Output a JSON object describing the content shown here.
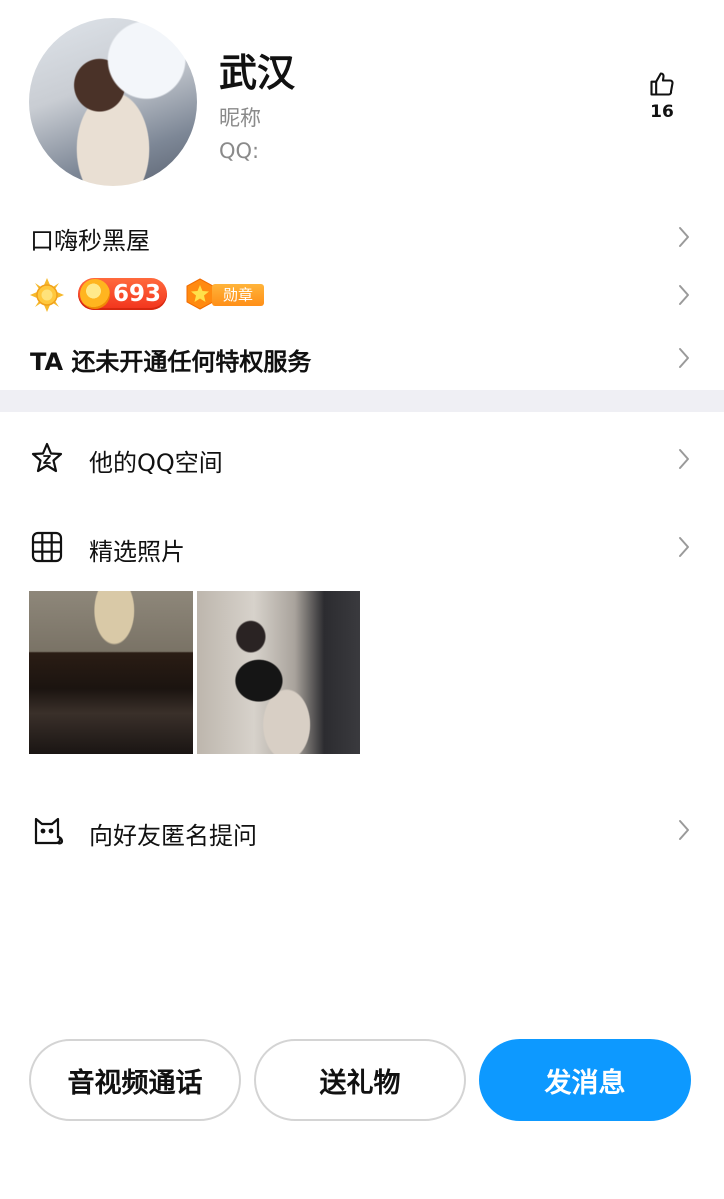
{
  "profile": {
    "name": "武汉",
    "nickname_label": "昵称",
    "qq_label": "QQ:",
    "like_count": "16"
  },
  "rows": {
    "space_name": "口嗨秒黑屋",
    "coin_count": "693",
    "medal_label": "勋章",
    "privilege_text": "TA 还未开通任何特权服务",
    "qzone_label": "他的QQ空间",
    "photos_label": "精选照片",
    "ask_label": "向好友匿名提问"
  },
  "icons": {
    "like": "thumbs-up-icon",
    "qzone": "star-icon",
    "photos": "grid-icon",
    "ask": "cat-icon",
    "chevron": "chevron-right-icon"
  },
  "buttons": {
    "call": "音视频通话",
    "gift": "送礼物",
    "message": "发消息"
  },
  "colors": {
    "primary": "#0d99ff",
    "divider": "#efeff4",
    "secondary_text": "#8a8a8a"
  }
}
